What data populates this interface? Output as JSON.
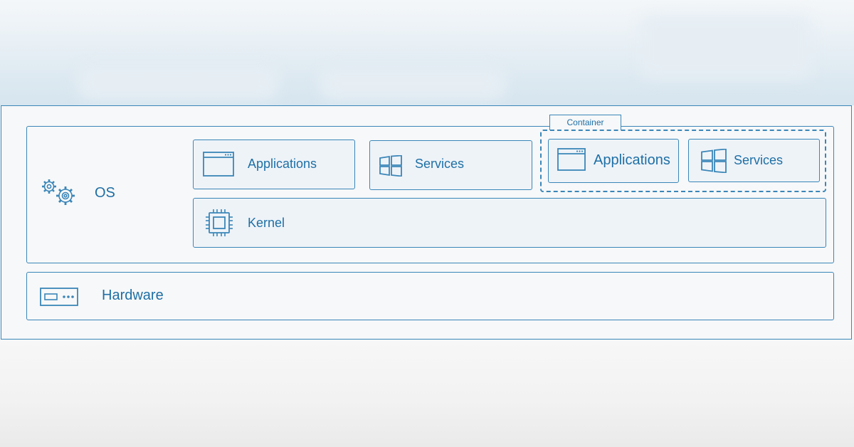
{
  "diagram": {
    "os": {
      "label": "OS",
      "icon": "gears-icon"
    },
    "applications": {
      "label": "Applications",
      "icon": "app-window-icon"
    },
    "services": {
      "label": "Services",
      "icon": "windows-logo-icon"
    },
    "kernel": {
      "label": "Kernel",
      "icon": "cpu-chip-icon"
    },
    "container": {
      "tag": "Container",
      "applications": {
        "label": "Applications"
      },
      "services": {
        "label": "Services"
      }
    },
    "hardware": {
      "label": "Hardware",
      "icon": "server-unit-icon"
    }
  },
  "colors": {
    "accent": "#3a86b8",
    "text": "#1e6fa5",
    "box_fill": "#eef3f8"
  }
}
